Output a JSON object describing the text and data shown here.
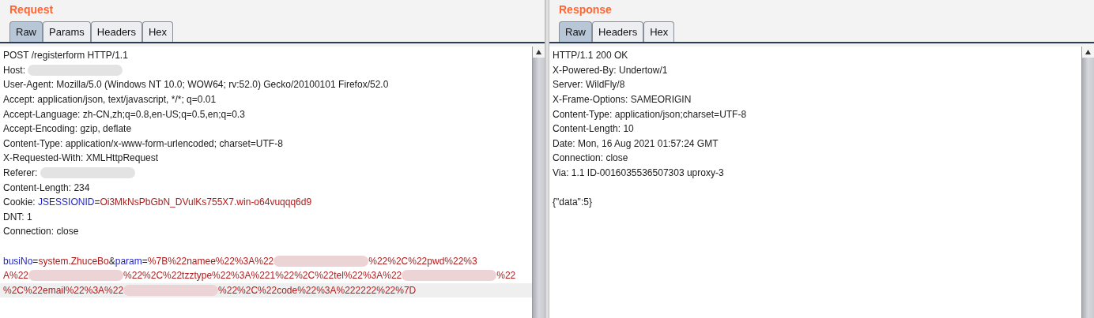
{
  "panes": [
    {
      "title": "Request",
      "tabs": [
        {
          "label": "Raw",
          "selected": true
        },
        {
          "label": "Params",
          "selected": false
        },
        {
          "label": "Headers",
          "selected": false
        },
        {
          "label": "Hex",
          "selected": false
        }
      ],
      "lines": [
        {
          "current": false,
          "segments": [
            {
              "kind": "text",
              "text": "POST /registerform HTTP/1.1"
            }
          ]
        },
        {
          "current": false,
          "segments": [
            {
              "kind": "text",
              "text": "Host: "
            },
            {
              "kind": "redacted"
            }
          ]
        },
        {
          "current": false,
          "segments": [
            {
              "kind": "text",
              "text": "User-Agent: Mozilla/5.0 (Windows NT 10.0; WOW64; rv:52.0) Gecko/20100101 Firefox/52.0"
            }
          ]
        },
        {
          "current": false,
          "segments": [
            {
              "kind": "text",
              "text": "Accept: application/json, text/javascript, */*; q=0.01"
            }
          ]
        },
        {
          "current": false,
          "segments": [
            {
              "kind": "text",
              "text": "Accept-Language: zh-CN,zh;q=0.8,en-US;q=0.5,en;q=0.3"
            }
          ]
        },
        {
          "current": false,
          "segments": [
            {
              "kind": "text",
              "text": "Accept-Encoding: gzip, deflate"
            }
          ]
        },
        {
          "current": false,
          "segments": [
            {
              "kind": "text",
              "text": "Content-Type: application/x-www-form-urlencoded; charset=UTF-8"
            }
          ]
        },
        {
          "current": false,
          "segments": [
            {
              "kind": "text",
              "text": "X-Requested-With: XMLHttpRequest"
            }
          ]
        },
        {
          "current": false,
          "segments": [
            {
              "kind": "text",
              "text": "Referer: "
            },
            {
              "kind": "redacted"
            }
          ]
        },
        {
          "current": false,
          "segments": [
            {
              "kind": "text",
              "text": "Content-Length: 234"
            }
          ]
        },
        {
          "current": false,
          "segments": [
            {
              "kind": "text",
              "text": "Cookie: "
            },
            {
              "kind": "name",
              "text": "JSESSIONID"
            },
            {
              "kind": "text",
              "text": "="
            },
            {
              "kind": "value",
              "text": "Oi3MkNsPbGbN_DVulKs755X7.win-o64vuqqq6d9"
            }
          ]
        },
        {
          "current": false,
          "segments": [
            {
              "kind": "text",
              "text": "DNT: 1"
            }
          ]
        },
        {
          "current": false,
          "segments": [
            {
              "kind": "text",
              "text": "Connection: close"
            }
          ]
        },
        {
          "current": false
        },
        {
          "current": false,
          "segments": [
            {
              "kind": "name",
              "text": "busiNo"
            },
            {
              "kind": "text",
              "text": "="
            },
            {
              "kind": "value",
              "text": "system.ZhuceBo"
            },
            {
              "kind": "text",
              "text": "&"
            },
            {
              "kind": "name",
              "text": "param"
            },
            {
              "kind": "text",
              "text": "="
            },
            {
              "kind": "value",
              "text": "%7B%22namee%22%3A%22"
            },
            {
              "kind": "redacted"
            },
            {
              "kind": "value",
              "text": "%22%2C%22pwd%22%3"
            }
          ]
        },
        {
          "current": false,
          "segments": [
            {
              "kind": "value",
              "text": "A%22"
            },
            {
              "kind": "redacted"
            },
            {
              "kind": "value",
              "text": "%22%2C%22tzztype%22%3A%221%22%2C%22tel%22%3A%22"
            },
            {
              "kind": "redacted"
            },
            {
              "kind": "value",
              "text": "%22"
            }
          ]
        },
        {
          "current": true,
          "segments": [
            {
              "kind": "value",
              "text": "%2C%22email%22%3A%22"
            },
            {
              "kind": "redacted"
            },
            {
              "kind": "value",
              "text": "%22%2C%22code%22%3A%222222%22%7D"
            }
          ]
        }
      ]
    },
    {
      "title": "Response",
      "tabs": [
        {
          "label": "Raw",
          "selected": true
        },
        {
          "label": "Headers",
          "selected": false
        },
        {
          "label": "Hex",
          "selected": false
        }
      ],
      "lines": [
        {
          "current": false,
          "segments": [
            {
              "kind": "text",
              "text": "HTTP/1.1 200 OK"
            }
          ]
        },
        {
          "current": false,
          "segments": [
            {
              "kind": "text",
              "text": "X-Powered-By: Undertow/1"
            }
          ]
        },
        {
          "current": false,
          "segments": [
            {
              "kind": "text",
              "text": "Server: WildFly/8"
            }
          ]
        },
        {
          "current": false,
          "segments": [
            {
              "kind": "text",
              "text": "X-Frame-Options: SAMEORIGIN"
            }
          ]
        },
        {
          "current": false,
          "segments": [
            {
              "kind": "text",
              "text": "Content-Type: application/json;charset=UTF-8"
            }
          ]
        },
        {
          "current": false,
          "segments": [
            {
              "kind": "text",
              "text": "Content-Length: 10"
            }
          ]
        },
        {
          "current": false,
          "segments": [
            {
              "kind": "text",
              "text": "Date: Mon, 16 Aug 2021 01:57:24 GMT"
            }
          ]
        },
        {
          "current": false,
          "segments": [
            {
              "kind": "text",
              "text": "Connection: close"
            }
          ]
        },
        {
          "current": false,
          "segments": [
            {
              "kind": "text",
              "text": "Via: 1.1 ID-0016035536507303 uproxy-3"
            }
          ]
        },
        {
          "current": false
        },
        {
          "current": false,
          "segments": [
            {
              "kind": "text",
              "text": "{\"data\":5}"
            }
          ]
        }
      ]
    }
  ]
}
